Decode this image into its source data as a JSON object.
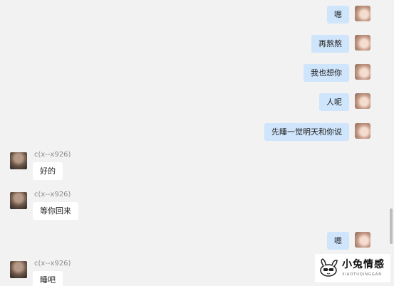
{
  "messages_out": [
    {
      "text": "嗯"
    },
    {
      "text": "再熬熬"
    },
    {
      "text": "我也想你"
    },
    {
      "text": "人呢"
    },
    {
      "text": "先睡一觉明天和你说"
    },
    {
      "text": "嗯"
    }
  ],
  "messages_in": [
    {
      "sender": "c(x--x926)",
      "text": "好的"
    },
    {
      "sender": "c(x--x926)",
      "text": "等你回来"
    },
    {
      "sender": "c(x--x926)",
      "text": "睡吧"
    }
  ],
  "watermark": {
    "name": "小兔情感",
    "sub": "XIAOTUQINGGAN",
    "icon": "rabbit-logo-icon"
  },
  "colors": {
    "background": "#f2f2f2",
    "outgoing_bubble": "#cfe5fb",
    "incoming_bubble": "#ffffff"
  }
}
